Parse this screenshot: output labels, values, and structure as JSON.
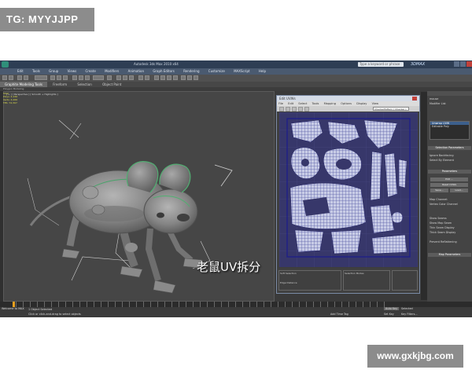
{
  "watermark_top": "TG: MYYJJPP",
  "watermark_bottom": "www.gxkjbg.com",
  "app": {
    "title": "Autodesk 3ds Max  2010  x64",
    "help_search_placeholder": "Type a keyword or phrase",
    "brand": "3DMAX",
    "menus": [
      "Edit",
      "Tools",
      "Group",
      "Views",
      "Create",
      "Modifiers",
      "Animation",
      "Graph Editors",
      "Rendering",
      "Customize",
      "MAXScript",
      "Help"
    ],
    "ribbon_tabs": [
      "Graphite Modeling Tools",
      "Freeform",
      "Selection",
      "Object Paint"
    ],
    "ribbon_sub": "Polygon Modeling",
    "viewport_label": "[ + ] [ Perspective ] [ Smooth + Highlights ]",
    "stats": [
      "Total",
      "Polys: 4,160",
      "Verts: 4,266",
      "FPS: 74,307"
    ],
    "caption": "老鼠UV拆分",
    "uv_window": {
      "title": "Edit UVWs",
      "menus": [
        "File",
        "Edit",
        "Select",
        "Tools",
        "Mapping",
        "Options",
        "Display",
        "View"
      ],
      "checker": "CheckerPattern ( Checker )",
      "sections": [
        "Soft Selection",
        "Selection Modes"
      ],
      "bottom_labels": [
        "Edge Distance"
      ]
    },
    "right_panel": {
      "name": "mouse",
      "modifier_list": "Modifier List",
      "stack": [
        "Unwrap UVW",
        "Editable Poly"
      ],
      "rollouts": [
        "Selection Parameters",
        "Parameters",
        "Map Parameters"
      ],
      "options": [
        "Ignore Backfacing",
        "Select By Element",
        "Show Seams",
        "Show Map Seam",
        "Thin Seam Display",
        "Thick Seam Display",
        "Prevent Reflattening"
      ],
      "buttons": [
        "Edit ...",
        "Reset UVWs",
        "Save...",
        "Load..."
      ],
      "channel": "Map Channel:",
      "vertex_color": "Vertex Color Channel"
    },
    "status": {
      "objects": "1 Object Selected",
      "click_prompt": "Click or click-and-drag to select objects",
      "welcome": "Welcome to MAX",
      "time_tag": "Add Time Tag",
      "auto_key": "Auto Key",
      "set_key": "Set Key",
      "selected": "Selected",
      "key_filters": "Key Filters..."
    }
  }
}
